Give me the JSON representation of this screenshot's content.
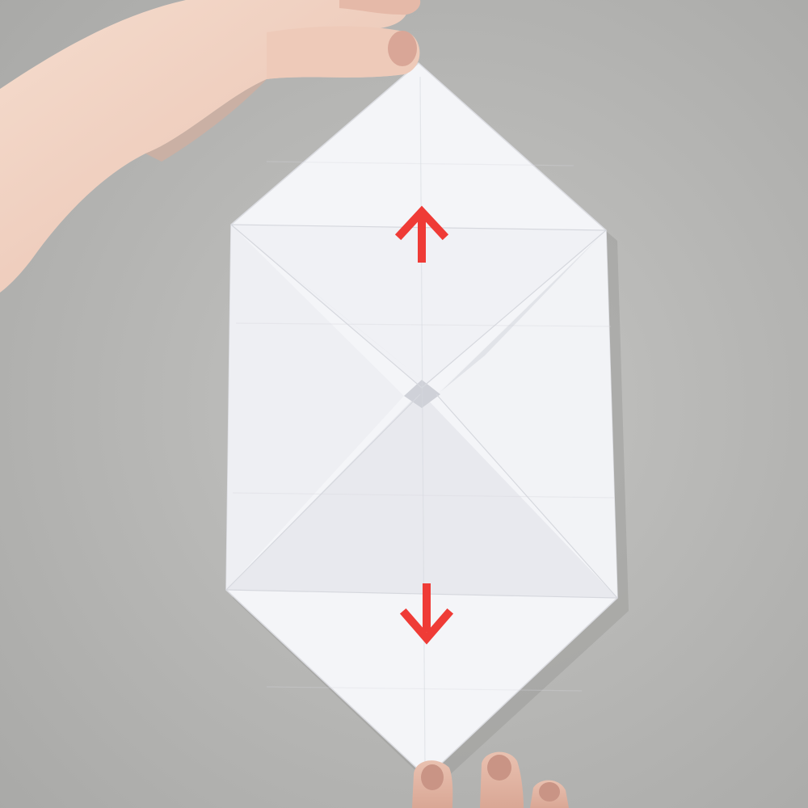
{
  "scene": {
    "surface_color": "#b9b9b7",
    "paper_color": "#f4f5f8",
    "arrow_color": "#ef3b36",
    "skin_color": "#f2d2c2",
    "arrows": [
      {
        "direction": "up"
      },
      {
        "direction": "down"
      }
    ]
  }
}
